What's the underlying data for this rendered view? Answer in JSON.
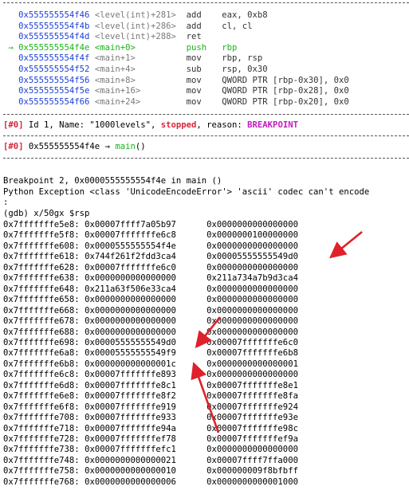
{
  "disasm": [
    {
      "marker": "",
      "addr": "0x555555554f46",
      "sym": "<level(int)+281>",
      "op": "add",
      "args": "eax, 0xb8",
      "current": false
    },
    {
      "marker": "",
      "addr": "0x555555554f4b",
      "sym": "<level(int)+286>",
      "op": "add",
      "args": "cl, cl",
      "current": false
    },
    {
      "marker": "",
      "addr": "0x555555554f4d",
      "sym": "<level(int)+288>",
      "op": "ret",
      "args": "",
      "current": false
    },
    {
      "marker": "→",
      "addr": "0x555555554f4e",
      "sym": "<main+0>",
      "op": "push",
      "args": "rbp",
      "current": true
    },
    {
      "marker": "",
      "addr": "0x555555554f4f",
      "sym": "<main+1>",
      "op": "mov",
      "args": "rbp, rsp",
      "current": false
    },
    {
      "marker": "",
      "addr": "0x555555554f52",
      "sym": "<main+4>",
      "op": "sub",
      "args": "rsp, 0x30",
      "current": false
    },
    {
      "marker": "",
      "addr": "0x555555554f56",
      "sym": "<main+8>",
      "op": "mov",
      "args": "QWORD PTR [rbp-0x30], 0x0",
      "current": false
    },
    {
      "marker": "",
      "addr": "0x555555554f5e",
      "sym": "<main+16>",
      "op": "mov",
      "args": "QWORD PTR [rbp-0x28], 0x0",
      "current": false
    },
    {
      "marker": "",
      "addr": "0x555555554f66",
      "sym": "<main+24>",
      "op": "mov",
      "args": "QWORD PTR [rbp-0x20], 0x0",
      "current": false
    }
  ],
  "thread": {
    "tag": "[#0]",
    "id_text": " Id 1, Name: \"1000levels\", ",
    "state": "stopped",
    "reason_label": ", reason: ",
    "reason": "BREAKPOINT"
  },
  "trace": {
    "tag": "[#0]",
    "addr": " 0x555555554f4e ",
    "arrow": "→",
    "fn": "main",
    "paren": "()"
  },
  "messages": [
    "Breakpoint 2, 0x0000555555554f4e in main ()",
    "Python Exception <class 'UnicodeEncodeError'> 'ascii' codec can't encode",
    ":"
  ],
  "prompt": "(gdb) x/50gx $rsp",
  "memory": [
    [
      "0x7fffffffe5e8:",
      "0x00007ffff7a05b97",
      "0x0000000000000000"
    ],
    [
      "0x7fffffffe5f8:",
      "0x00007fffffffe6c8",
      "0x0000000100000000"
    ],
    [
      "0x7fffffffe608:",
      "0x0000555555554f4e",
      "0x0000000000000000"
    ],
    [
      "0x7fffffffe618:",
      "0x744f261f2fdd3ca4",
      "0x00005555555549d0"
    ],
    [
      "0x7fffffffe628:",
      "0x00007fffffffe6c0",
      "0x0000000000000000"
    ],
    [
      "0x7fffffffe638:",
      "0x0000000000000000",
      "0x211a734a7b9d3ca4"
    ],
    [
      "0x7fffffffe648:",
      "0x211a63f506e33ca4",
      "0x0000000000000000"
    ],
    [
      "0x7fffffffe658:",
      "0x0000000000000000",
      "0x0000000000000000"
    ],
    [
      "0x7fffffffe668:",
      "0x0000000000000000",
      "0x0000000000000000"
    ],
    [
      "0x7fffffffe678:",
      "0x0000000000000000",
      "0x0000000000000000"
    ],
    [
      "0x7fffffffe688:",
      "0x0000000000000000",
      "0x0000000000000000"
    ],
    [
      "0x7fffffffe698:",
      "0x00005555555549d0",
      "0x00007fffffffe6c0"
    ],
    [
      "0x7fffffffe6a8:",
      "0x00005555555549f9",
      "0x00007fffffffe6b8"
    ],
    [
      "0x7fffffffe6b8:",
      "0x000000000000001c",
      "0x0000000000000001"
    ],
    [
      "0x7fffffffe6c8:",
      "0x00007fffffffe893",
      "0x0000000000000000"
    ],
    [
      "0x7fffffffe6d8:",
      "0x00007fffffffe8c1",
      "0x00007fffffffe8e1"
    ],
    [
      "0x7fffffffe6e8:",
      "0x00007fffffffe8f2",
      "0x00007fffffffe8fa"
    ],
    [
      "0x7fffffffe6f8:",
      "0x00007fffffffe919",
      "0x00007fffffffe924"
    ],
    [
      "0x7fffffffe708:",
      "0x00007fffffffe933",
      "0x00007fffffffe93e"
    ],
    [
      "0x7fffffffe718:",
      "0x00007fffffffe94a",
      "0x00007fffffffe98c"
    ],
    [
      "0x7fffffffe728:",
      "0x00007fffffffef78",
      "0x00007fffffffef9a"
    ],
    [
      "0x7fffffffe738:",
      "0x00007fffffffefc1",
      "0x0000000000000000"
    ],
    [
      "0x7fffffffe748:",
      "0x0000000000000021",
      "0x00007ffff7ffa000"
    ],
    [
      "0x7fffffffe758:",
      "0x0000000000000010",
      "0x000000009f8bfbff"
    ],
    [
      "0x7fffffffe768:",
      "0x0000000000000006",
      "0x0000000000001000"
    ]
  ],
  "colors": {
    "separator": "#555555",
    "current_line": "#18b518",
    "state": "#d6263b",
    "reason": "#c419c4",
    "annotation_arrow": "#e0202a"
  }
}
